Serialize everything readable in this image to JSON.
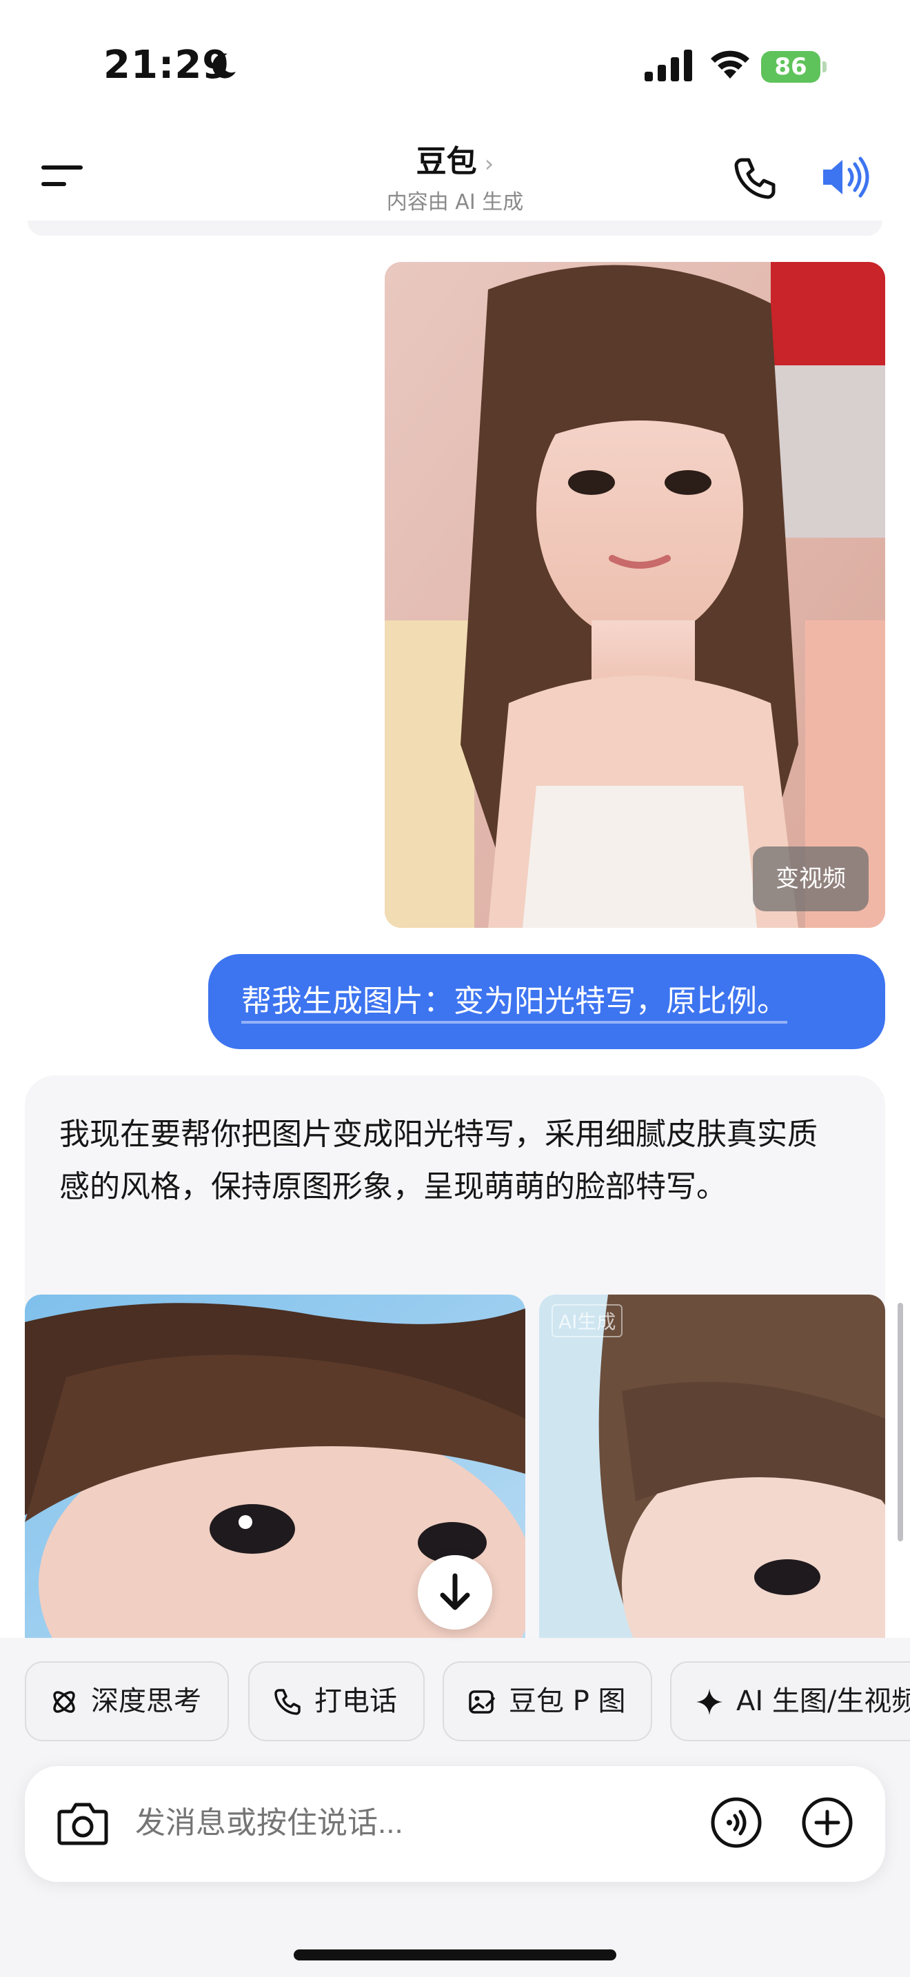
{
  "status_bar": {
    "time": "21:29",
    "battery": "86"
  },
  "header": {
    "title": "豆包",
    "title_chevron": "›",
    "subtitle": "内容由 AI 生成"
  },
  "chat": {
    "sent_photo_button": "变视频",
    "user_message": "帮我生成图片：变为阳光特写，原比例。",
    "bot_message": "我现在要帮你把图片变成阳光特写，采用细腻皮肤真实质感的风格，保持原图形象，呈现萌萌的脸部特写。",
    "ai_tag": "AI生成"
  },
  "chips": [
    {
      "label": "深度思考",
      "icon": "atom-icon"
    },
    {
      "label": "打电话",
      "icon": "phone-icon"
    },
    {
      "label": "豆包 P 图",
      "icon": "image-edit-icon"
    },
    {
      "label": "AI 生图/生视频",
      "icon": "sparkle-icon"
    }
  ],
  "input": {
    "placeholder": "发消息或按住说话..."
  },
  "colors": {
    "accent": "#3d74f0",
    "battery": "#5fc35b"
  }
}
